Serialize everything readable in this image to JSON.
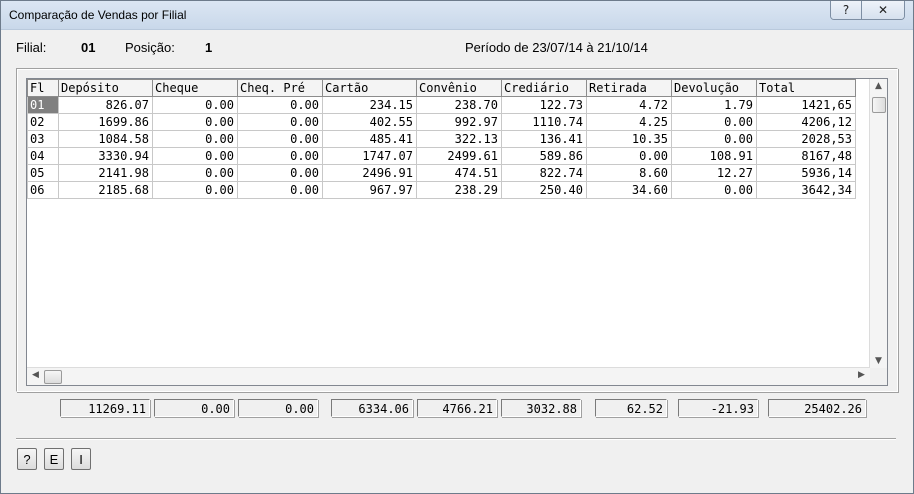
{
  "window": {
    "title": "Comparação de Vendas por Filial",
    "help_glyph": "?",
    "close_glyph": "✕"
  },
  "info": {
    "filial_label": "Filial:",
    "filial_value": "01",
    "posicao_label": "Posição:",
    "posicao_value": "1",
    "periodo": "Período de 23/07/14 à 21/10/14"
  },
  "table": {
    "columns": [
      "Fl",
      "Depósito",
      "Cheque",
      "Cheq. Pré",
      "Cartão",
      "Convênio",
      "Crediário",
      "Retirada",
      "Devolução",
      "Total"
    ],
    "rows": [
      [
        "01",
        "826.07",
        "0.00",
        "0.00",
        "234.15",
        "238.70",
        "122.73",
        "4.72",
        "1.79",
        "1421,65"
      ],
      [
        "02",
        "1699.86",
        "0.00",
        "0.00",
        "402.55",
        "992.97",
        "1110.74",
        "4.25",
        "0.00",
        "4206,12"
      ],
      [
        "03",
        "1084.58",
        "0.00",
        "0.00",
        "485.41",
        "322.13",
        "136.41",
        "10.35",
        "0.00",
        "2028,53"
      ],
      [
        "04",
        "3330.94",
        "0.00",
        "0.00",
        "1747.07",
        "2499.61",
        "589.86",
        "0.00",
        "108.91",
        "8167,48"
      ],
      [
        "05",
        "2141.98",
        "0.00",
        "0.00",
        "2496.91",
        "474.51",
        "822.74",
        "8.60",
        "12.27",
        "5936,14"
      ],
      [
        "06",
        "2185.68",
        "0.00",
        "0.00",
        "967.97",
        "238.29",
        "250.40",
        "34.60",
        "0.00",
        "3642,34"
      ]
    ],
    "selected_row": 0
  },
  "totals": [
    "11269.11",
    "0.00",
    "0.00",
    "6334.06",
    "4766.21",
    "3032.88",
    "62.52",
    "-21.93",
    "25402.26"
  ],
  "buttons": {
    "help": "?",
    "e": "E",
    "i": "I"
  }
}
